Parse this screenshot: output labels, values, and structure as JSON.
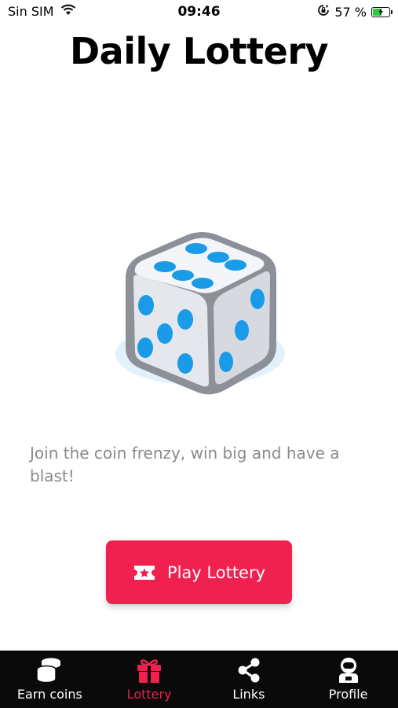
{
  "status_bar": {
    "carrier": "Sin SIM",
    "time": "09:46",
    "battery_percent": "57 %",
    "battery_level": 0.57,
    "wifi_icon": "wifi-icon",
    "orientation_lock_icon": "orientation-lock-icon"
  },
  "page": {
    "title": "Daily Lottery",
    "illustration_icon": "dice-icon",
    "description": "Join the coin frenzy, win big and have a blast!"
  },
  "play_button": {
    "label": "Play Lottery",
    "icon": "ticket-icon",
    "color": "#f0204f"
  },
  "tab_bar": {
    "active_color": "#f0204f",
    "background": "#0a0a0a",
    "tabs": [
      {
        "label": "Earn coins",
        "icon": "coins-icon",
        "active": false
      },
      {
        "label": "Lottery",
        "icon": "gift-icon",
        "active": true
      },
      {
        "label": "Links",
        "icon": "share-icon",
        "active": false
      },
      {
        "label": "Profile",
        "icon": "astronaut-icon",
        "active": false
      }
    ]
  }
}
